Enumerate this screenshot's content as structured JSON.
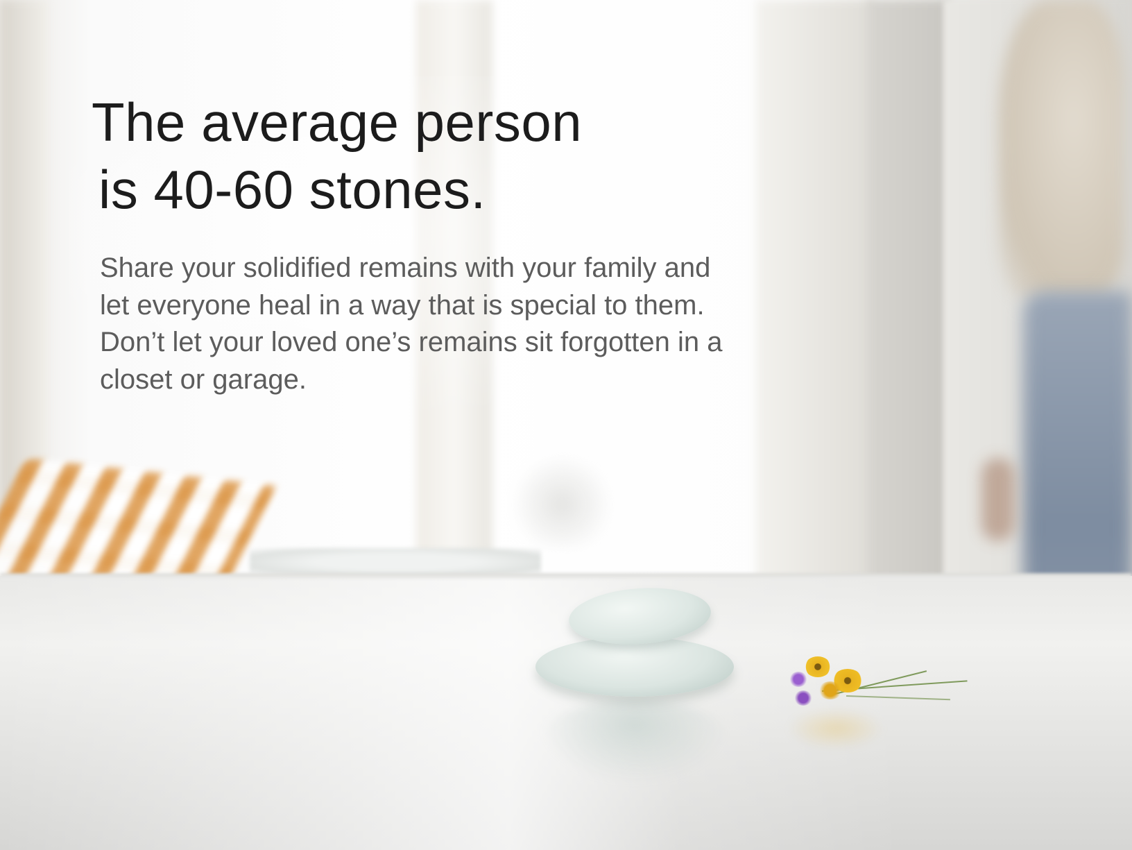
{
  "headline": {
    "line1": "The average person",
    "line2": "is 40-60 stones."
  },
  "body": {
    "lines": [
      "Share your solidified remains with your family and",
      "let everyone heal in a way that is special to them.",
      "Don’t let your loved one’s remains sit forgotten in a",
      "closet or garage."
    ]
  },
  "colors": {
    "headline": "#1c1c1c",
    "body_text": "#5c5c5c",
    "stones": "#dde7e3",
    "flowers_yellow": "#e8b320",
    "flowers_purple": "#8a4fc0"
  }
}
